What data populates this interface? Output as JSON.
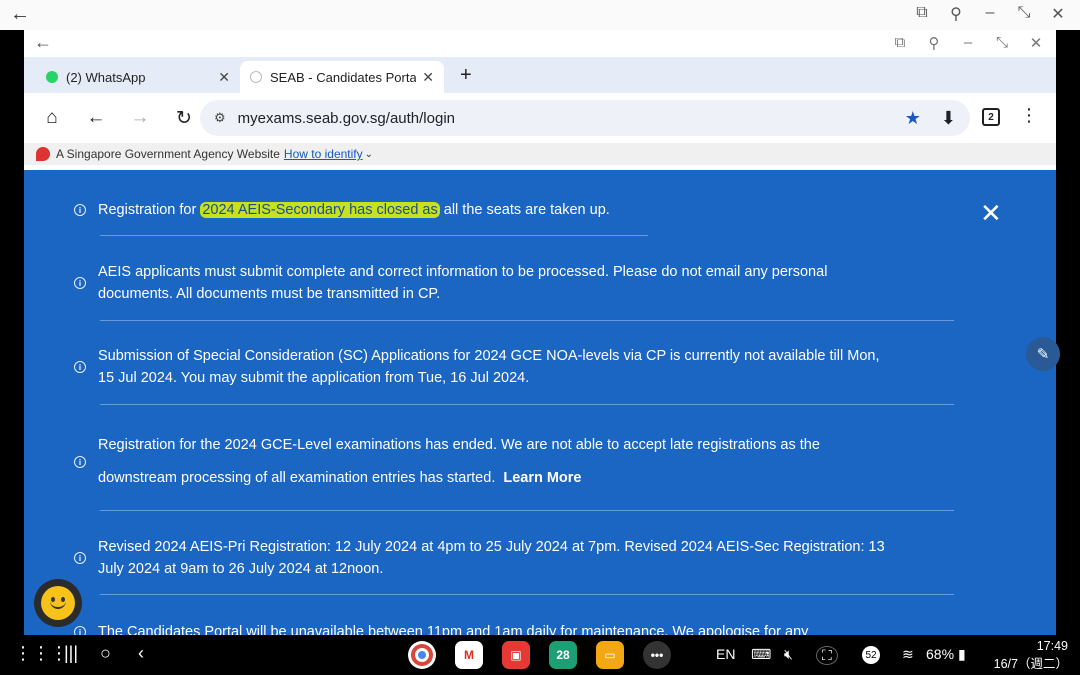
{
  "browser": {
    "tabs": [
      {
        "title": "(2) WhatsApp",
        "icon": "whatsapp-icon"
      },
      {
        "title": "SEAB - Candidates Portal",
        "icon": "seab-favicon-icon"
      }
    ],
    "url": "myexams.seab.gov.sg/auth/login",
    "tab_count": "2",
    "gov_banner": "A Singapore Government Agency Website",
    "gov_link": "How to identify"
  },
  "notices": [
    {
      "pre": "Registration for ",
      "highlight": "2024 AEIS-Secondary has closed as",
      "post": " all the seats are taken up."
    },
    {
      "line1": "AEIS applicants must submit complete and correct information to be processed. Please do not email any personal",
      "line2": "documents. All documents must be transmitted in CP."
    },
    {
      "line1": "Submission of Special Consideration (SC) Applications for 2024 GCE NOA-levels via CP is currently not available till Mon,",
      "line2": "15 Jul 2024. You may submit the application from Tue, 16 Jul 2024."
    },
    {
      "line1": "Registration for the 2024 GCE-Level examinations has ended. We are not able to accept late registrations as the",
      "line2": "downstream processing of all examination entries has started.",
      "link": "Learn More"
    },
    {
      "line1": "Revised 2024 AEIS-Pri Registration: 12 July 2024 at 4pm to 25 July 2024 at 7pm. Revised 2024 AEIS-Sec Registration: 13",
      "line2": "July 2024 at 9am to 26 July 2024 at 12noon."
    },
    {
      "line1": "The Candidates Portal will be unavailable between 11pm and 1am daily for maintenance. We apologise for any"
    }
  ],
  "taskbar": {
    "language": "EN",
    "calendar_day": "28",
    "notification_count": "52",
    "battery": "68%",
    "time": "17:49",
    "date": "16/7（週二）"
  },
  "colors": {
    "content_bg": "#1b65c3",
    "highlight": "#c9e01f"
  }
}
